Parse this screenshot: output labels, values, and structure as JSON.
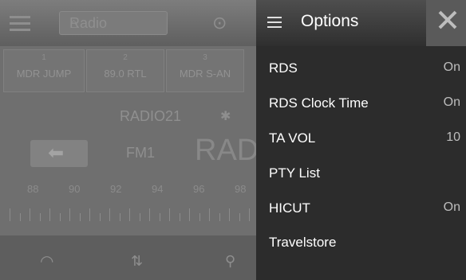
{
  "background": {
    "title": "Radio",
    "presets": [
      {
        "num": "1",
        "label": "MDR JUMP"
      },
      {
        "num": "2",
        "label": "89.0 RTL"
      },
      {
        "num": "3",
        "label": "MDR S-AN"
      }
    ],
    "station_name": "RADIO21",
    "band": "FM1",
    "station_large": "RAD",
    "frequencies": [
      "88",
      "90",
      "92",
      "94",
      "96",
      "98"
    ]
  },
  "options_panel": {
    "title": "Options",
    "items": [
      {
        "label": "RDS",
        "value": "On"
      },
      {
        "label": "RDS Clock Time",
        "value": "On"
      },
      {
        "label": "TA VOL",
        "value": "10"
      },
      {
        "label": "PTY List",
        "value": ""
      },
      {
        "label": "HICUT",
        "value": "On"
      },
      {
        "label": "Travelstore",
        "value": ""
      }
    ]
  }
}
